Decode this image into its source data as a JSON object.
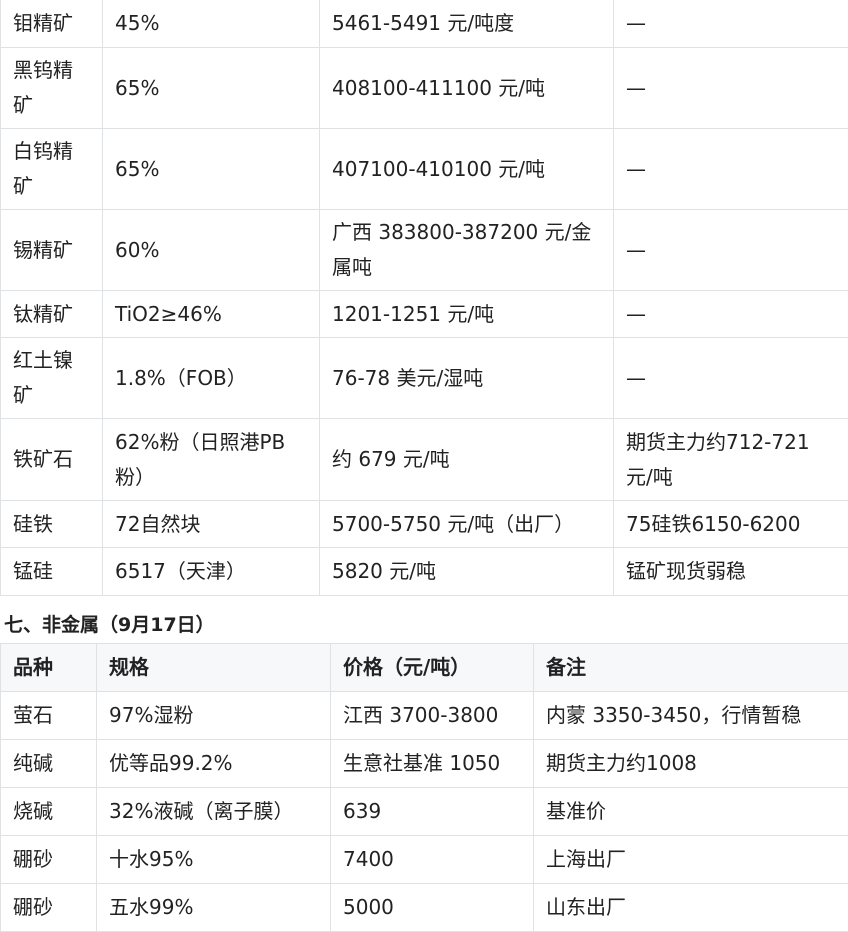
{
  "table1": {
    "rows": [
      {
        "name": "钼精矿",
        "spec": "45%",
        "price": "5461-5491 元/吨度",
        "note": "—"
      },
      {
        "name": "黑钨精矿",
        "spec": "65%",
        "price": "408100-411100 元/吨",
        "note": "—"
      },
      {
        "name": "白钨精矿",
        "spec": "65%",
        "price": "407100-410100 元/吨",
        "note": "—"
      },
      {
        "name": "锡精矿",
        "spec": "60%",
        "price": "广西 383800-387200 元/金属吨",
        "note": "—"
      },
      {
        "name": "钛精矿",
        "spec": "TiO2≥46%",
        "price": "1201-1251 元/吨",
        "note": "—"
      },
      {
        "name": "红土镍矿",
        "spec": "1.8%（FOB）",
        "price": "76-78 美元/湿吨",
        "note": "—"
      },
      {
        "name": "铁矿石",
        "spec": "62%粉（日照港PB粉）",
        "price": "约 679 元/吨",
        "note": "期货主力约712-721元/吨"
      },
      {
        "name": "硅铁",
        "spec": "72自然块",
        "price": "5700-5750 元/吨（出厂）",
        "note": "75硅铁6150-6200"
      },
      {
        "name": "锰硅",
        "spec": "6517（天津）",
        "price": "5820 元/吨",
        "note": "锰矿现货弱稳"
      }
    ]
  },
  "section": {
    "title": "七、非金属（9月17日）"
  },
  "table2": {
    "headers": {
      "name": "品种",
      "spec": "规格",
      "price": "价格（元/吨）",
      "note": "备注"
    },
    "rows": [
      {
        "name": "萤石",
        "spec": "97%湿粉",
        "price": "江西 3700-3800",
        "note": "内蒙 3350-3450，行情暂稳"
      },
      {
        "name": "纯碱",
        "spec": "优等品99.2%",
        "price": "生意社基准 1050",
        "note": "期货主力约1008"
      },
      {
        "name": "烧碱",
        "spec": "32%液碱（离子膜）",
        "price": "639",
        "note": "基准价"
      },
      {
        "name": "硼砂",
        "spec": "十水95%",
        "price": "7400",
        "note": "上海出厂"
      },
      {
        "name": "硼砂",
        "spec": "五水99%",
        "price": "5000",
        "note": "山东出厂"
      }
    ]
  }
}
